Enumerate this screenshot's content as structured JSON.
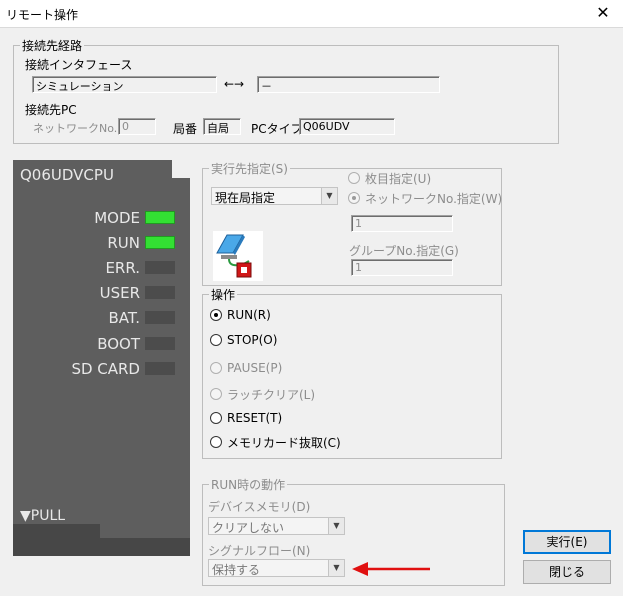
{
  "window": {
    "title": "リモート操作",
    "close_glyph": "✕"
  },
  "route": {
    "legend": "接続先経路",
    "interface_label": "接続インタフェース",
    "interface_value": "シミュレーション",
    "arrow": "←→",
    "interface_target": "－",
    "pc_label": "接続先PC",
    "network_no_label": "ネットワークNo.",
    "network_no_value": "0",
    "station_label": "局番",
    "station_value": "自局",
    "pc_type_label": "PCタイプ",
    "pc_type_value": "Q06UDV"
  },
  "cpu": {
    "model": "Q06UDVCPU",
    "leds": [
      {
        "label": "MODE",
        "on": true
      },
      {
        "label": "RUN",
        "on": true
      },
      {
        "label": "ERR.",
        "on": false
      },
      {
        "label": "USER",
        "on": false
      },
      {
        "label": "BAT.",
        "on": false
      },
      {
        "label": "BOOT",
        "on": false
      },
      {
        "label": "SD CARD",
        "on": false
      }
    ],
    "pull_label": "▼PULL",
    "led_on_color": "#33e033"
  },
  "target": {
    "legend": "実行先指定(S)",
    "select_value": "現在局指定",
    "radio_multi": "枚目指定(U)",
    "radio_network": "ネットワークNo.指定(W)",
    "network_input": "1",
    "group_label": "グループNo.指定(G)",
    "group_input": "1"
  },
  "operation": {
    "legend": "操作",
    "options": [
      {
        "label": "RUN(R)",
        "checked": true,
        "enabled": true
      },
      {
        "label": "STOP(O)",
        "checked": false,
        "enabled": true
      },
      {
        "label": "PAUSE(P)",
        "checked": false,
        "enabled": false
      },
      {
        "label": "ラッチクリア(L)",
        "checked": false,
        "enabled": false
      },
      {
        "label": "RESET(T)",
        "checked": false,
        "enabled": true
      },
      {
        "label": "メモリカード抜取(C)",
        "checked": false,
        "enabled": true
      }
    ]
  },
  "run_action": {
    "legend": "RUN時の動作",
    "device_memory_label": "デバイスメモリ(D)",
    "device_memory_value": "クリアしない",
    "signal_flow_label": "シグナルフロー(N)",
    "signal_flow_value": "保持する"
  },
  "buttons": {
    "execute": "実行(E)",
    "close": "閉じる"
  },
  "annotation": {
    "arrow_color": "#e01010"
  }
}
